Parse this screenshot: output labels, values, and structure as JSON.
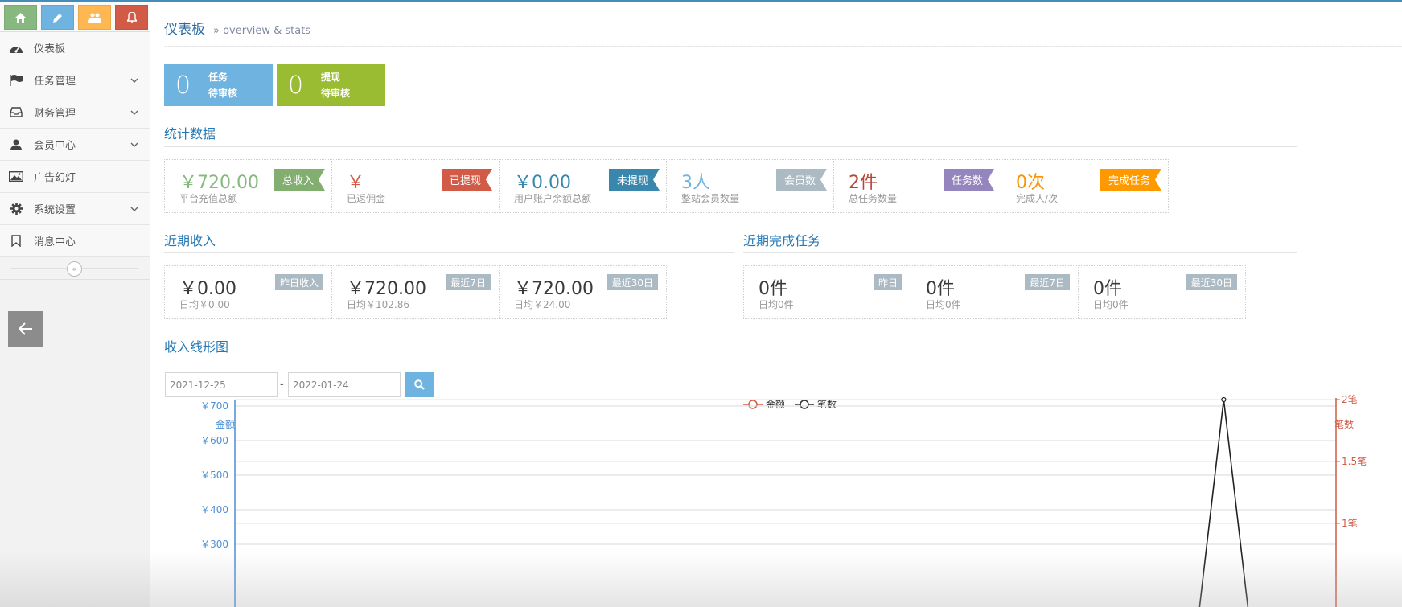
{
  "breadcrumb": {
    "title": "仪表板",
    "subtitle": "» overview & stats"
  },
  "sidebar": {
    "items": [
      {
        "label": "仪表板",
        "icon": "dashboard-icon",
        "has_children": false
      },
      {
        "label": "任务管理",
        "icon": "flag-icon",
        "has_children": true
      },
      {
        "label": "财务管理",
        "icon": "inbox-icon",
        "has_children": true
      },
      {
        "label": "会员中心",
        "icon": "user-icon",
        "has_children": true
      },
      {
        "label": "广告幻灯",
        "icon": "picture-icon",
        "has_children": false
      },
      {
        "label": "系统设置",
        "icon": "gear-icon",
        "has_children": true
      },
      {
        "label": "消息中心",
        "icon": "bookmark-icon",
        "has_children": false
      }
    ],
    "collapse_symbol": "«"
  },
  "pending": [
    {
      "num": "0",
      "line1": "任务",
      "line2": "待审核",
      "color": "#6fb3e0"
    },
    {
      "num": "0",
      "line1": "提现",
      "line2": "待审核",
      "color": "#9abc32"
    }
  ],
  "stats": {
    "title": "统计数据",
    "boxes": [
      {
        "value": "￥720.00",
        "label": "平台充值总额",
        "tag": "总收入",
        "value_color": "#87b87f",
        "tag_color": "#82af6f"
      },
      {
        "value": "￥",
        "label": "已返佣金",
        "tag": "已提现",
        "value_color": "#d15b47",
        "tag_color": "#d15b47"
      },
      {
        "value": "￥0.00",
        "label": "用户账户余额总额",
        "tag": "未提现",
        "value_color": "#3a87ad",
        "tag_color": "#3a87ad"
      },
      {
        "value": "3人",
        "label": "整站会员数量",
        "tag": "会员数",
        "value_color": "#6fb3e0",
        "tag_color": "#abbac3"
      },
      {
        "value": "2件",
        "label": "总任务数量",
        "tag": "任务数",
        "value_color": "#b74635",
        "tag_color": "#9585bf"
      },
      {
        "value": "0次",
        "label": "完成人/次",
        "tag": "完成任务",
        "value_color": "#f89406",
        "tag_color": "#ff9900"
      }
    ]
  },
  "recent_income": {
    "title": "近期收入",
    "boxes": [
      {
        "value": "￥0.00",
        "sub": "日均￥0.00",
        "badge": "昨日收入"
      },
      {
        "value": "￥720.00",
        "sub": "日均￥102.86",
        "badge": "最近7日"
      },
      {
        "value": "￥720.00",
        "sub": "日均￥24.00",
        "badge": "最近30日"
      }
    ]
  },
  "recent_tasks": {
    "title": "近期完成任务",
    "boxes": [
      {
        "value": "0件",
        "sub": "日均0件",
        "badge": "昨日"
      },
      {
        "value": "0件",
        "sub": "日均0件",
        "badge": "最近7日"
      },
      {
        "value": "0件",
        "sub": "日均0件",
        "badge": "最近30日"
      }
    ]
  },
  "line_chart_section": {
    "title": "收入线形图",
    "date_from": "2021-12-25",
    "date_to": "2022-01-24",
    "date_separator": "-"
  },
  "chart_data": {
    "type": "line",
    "legend": [
      "金额",
      "笔数"
    ],
    "legend_position": "top-center",
    "left_axis": {
      "label": "金额",
      "ticks": [
        "￥700",
        "￥600",
        "￥500",
        "￥400",
        "￥300"
      ],
      "visible_range": [
        300,
        700
      ],
      "color": "#4a8fd6"
    },
    "right_axis": {
      "label": "笔数",
      "ticks": [
        "2笔",
        "1.5笔",
        "1笔"
      ],
      "visible_range": [
        1,
        2
      ],
      "color": "#d15b47"
    },
    "series": [
      {
        "name": "笔数",
        "color": "#222222",
        "peak_value": 2,
        "peak_position_fraction": 0.898
      }
    ]
  }
}
